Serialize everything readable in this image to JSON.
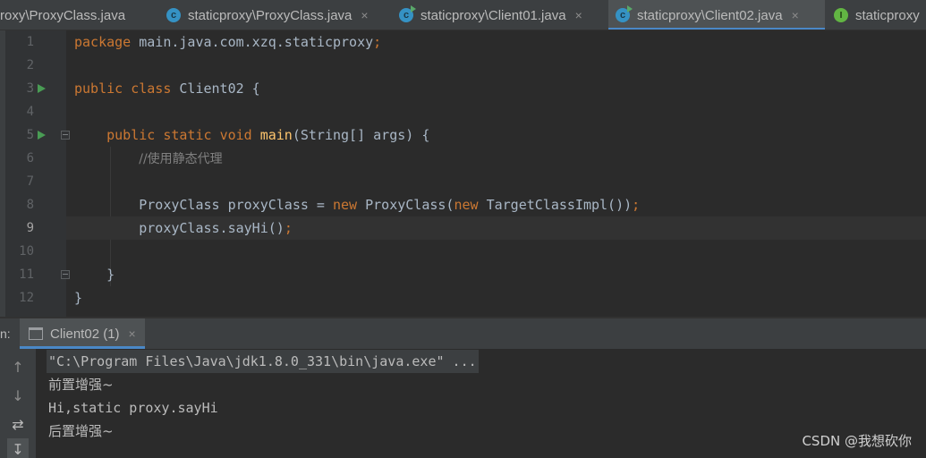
{
  "tabs": [
    {
      "label": "roxy\\ProxyClass.java",
      "icon": "class-icon",
      "active": false
    },
    {
      "label": "staticproxy\\ProxyClass.java",
      "icon": "class-icon",
      "active": false
    },
    {
      "label": "staticproxy\\Client01.java",
      "icon": "runnable-class-icon",
      "active": false
    },
    {
      "label": "staticproxy\\Client02.java",
      "icon": "runnable-class-icon",
      "active": true
    },
    {
      "label": "staticproxy",
      "icon": "interface-icon",
      "active": false
    }
  ],
  "tab_close_glyph": "×",
  "editor": {
    "current_line": 9,
    "lines": [
      {
        "n": "1",
        "text": "package main.java.com.xzq.staticproxy;"
      },
      {
        "n": "2",
        "text": ""
      },
      {
        "n": "3",
        "text": "public class Client02 {"
      },
      {
        "n": "4",
        "text": ""
      },
      {
        "n": "5",
        "text": "    public static void main(String[] args) {"
      },
      {
        "n": "6",
        "text": "        //使用静态代理"
      },
      {
        "n": "7",
        "text": ""
      },
      {
        "n": "8",
        "text": "        ProxyClass proxyClass = new ProxyClass(new TargetClassImpl());"
      },
      {
        "n": "9",
        "text": "        proxyClass.sayHi();"
      },
      {
        "n": "10",
        "text": ""
      },
      {
        "n": "11",
        "text": "    }"
      },
      {
        "n": "12",
        "text": "}"
      }
    ],
    "tokens": {
      "l1": {
        "kw": "package",
        "rest": " main.java.com.xzq.staticproxy",
        "semi": ";"
      },
      "l3": {
        "kw1": "public",
        "kw2": "class",
        "rest": " Client02 {"
      },
      "l5": {
        "indent": "    ",
        "kw1": "public",
        "kw2": "static",
        "kw3": "void",
        "fn": "main",
        "rest": "(String[] args) {"
      },
      "l6": {
        "indent": "        ",
        "comment": "//使用静态代理"
      },
      "l8": {
        "indent": "        ",
        "a": "ProxyClass proxyClass = ",
        "kw1": "new",
        "b": " ProxyClass(",
        "kw2": "new",
        "c": " TargetClassImpl())",
        "semi": ";"
      },
      "l9": {
        "indent": "        ",
        "a": "proxyClass.sayHi()",
        "semi": ";"
      },
      "l11": {
        "indent": "    ",
        "a": "}"
      },
      "l12": {
        "a": "}"
      }
    }
  },
  "run_panel": {
    "prefix": "n:",
    "tab_label": "Client02 (1)",
    "close_glyph": "×",
    "output": [
      "\"C:\\Program Files\\Java\\jdk1.8.0_331\\bin\\java.exe\" ...",
      "前置增强~",
      "Hi,static proxy.sayHi",
      "后置增强~"
    ],
    "tools": [
      "arrow-up-icon",
      "arrow-down-icon",
      "soft-wrap-icon",
      "scroll-to-end-icon"
    ]
  },
  "watermark": "CSDN @我想砍你",
  "colors": {
    "keyword": "#cc7832",
    "function": "#ffc66d",
    "comment": "#808080",
    "text": "#a9b7c6",
    "accent": "#4a88c7"
  }
}
